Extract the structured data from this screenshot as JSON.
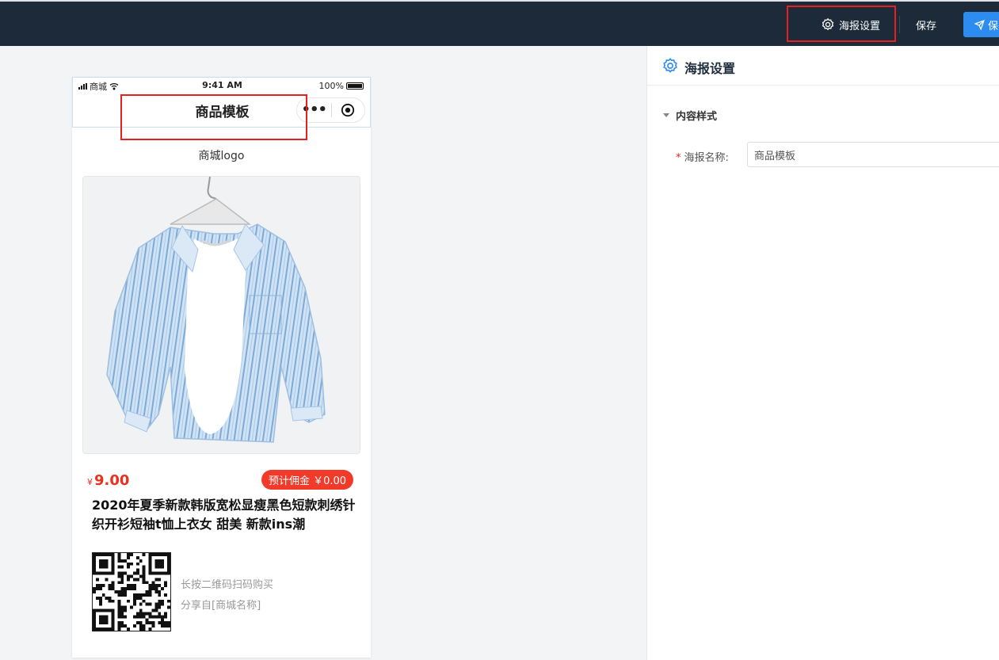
{
  "topbar": {
    "poster_settings_label": "海报设置",
    "save_label": "保存",
    "publish_label": "保",
    "colors": {
      "bar_bg": "#1d2a3a",
      "primary": "#2d8cf0",
      "highlight": "#e5201e"
    }
  },
  "phone": {
    "status": {
      "carrier": "商城",
      "time": "9:41 AM",
      "battery": "100%"
    },
    "nav_title": "商品模板",
    "logo_text": "商城logo",
    "product": {
      "currency": "¥",
      "price": "9.00",
      "commission": "预计佣金 ￥0.00",
      "title": "2020年夏季新款韩版宽松显瘦黑色短款刺绣针织开衫短袖t恤上衣女 甜美 新款ins潮",
      "image_icon": "striped-shirt-image"
    },
    "qr": {
      "line1": "长按二维码扫码购买",
      "line2": "分享自[商城名称]"
    }
  },
  "panel": {
    "title": "海报设置",
    "section_label": "内容样式",
    "form": {
      "required_mark": "*",
      "name_label": "海报名称:",
      "name_value": "商品模板"
    }
  }
}
